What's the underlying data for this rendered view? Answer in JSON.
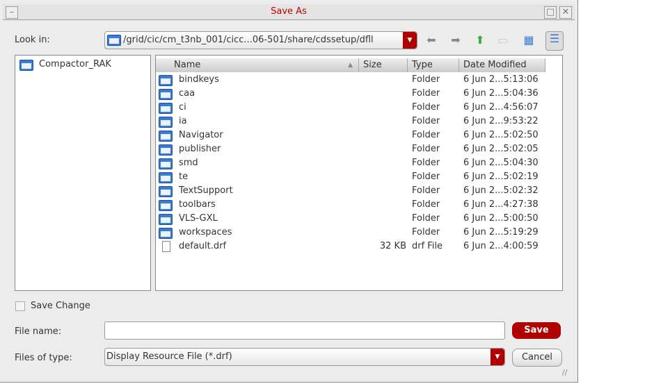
{
  "title": "Save As",
  "look_in_label": "Look in:",
  "look_in_path": "/grid/cic/cm_t3nb_001/cicc...06-501/share/cdssetup/dfll",
  "left_items": [
    "Compactor_RAK"
  ],
  "columns": {
    "name": "Name",
    "size": "Size",
    "type": "Type",
    "date": "Date Modified"
  },
  "files": [
    {
      "name": "bindkeys",
      "size": "",
      "type": "Folder",
      "date": "6 Jun 2...5:13:06",
      "kind": "folder"
    },
    {
      "name": "caa",
      "size": "",
      "type": "Folder",
      "date": "6 Jun 2...5:04:36",
      "kind": "folder"
    },
    {
      "name": "ci",
      "size": "",
      "type": "Folder",
      "date": "6 Jun 2...4:56:07",
      "kind": "folder"
    },
    {
      "name": "ia",
      "size": "",
      "type": "Folder",
      "date": "6 Jun 2...9:53:22",
      "kind": "folder"
    },
    {
      "name": "Navigator",
      "size": "",
      "type": "Folder",
      "date": "6 Jun 2...5:02:50",
      "kind": "folder"
    },
    {
      "name": "publisher",
      "size": "",
      "type": "Folder",
      "date": "6 Jun 2...5:02:05",
      "kind": "folder"
    },
    {
      "name": "smd",
      "size": "",
      "type": "Folder",
      "date": "6 Jun 2...5:04:30",
      "kind": "folder"
    },
    {
      "name": "te",
      "size": "",
      "type": "Folder",
      "date": "6 Jun 2...5:02:19",
      "kind": "folder"
    },
    {
      "name": "TextSupport",
      "size": "",
      "type": "Folder",
      "date": "6 Jun 2...5:02:32",
      "kind": "folder"
    },
    {
      "name": "toolbars",
      "size": "",
      "type": "Folder",
      "date": "6 Jun 2...4:27:38",
      "kind": "folder"
    },
    {
      "name": "VLS-GXL",
      "size": "",
      "type": "Folder",
      "date": "6 Jun 2...5:00:50",
      "kind": "folder"
    },
    {
      "name": "workspaces",
      "size": "",
      "type": "Folder",
      "date": "6 Jun 2...5:19:29",
      "kind": "folder"
    },
    {
      "name": "default.drf",
      "size": "32 KB",
      "type": "drf File",
      "date": "6 Jun 2...4:00:59",
      "kind": "file"
    }
  ],
  "save_change_label": "Save Change",
  "file_name_label": "File name:",
  "file_name_value": "",
  "files_of_type_label": "Files of type:",
  "files_of_type_value": "Display Resource File (*.drf)",
  "save_button": "Save",
  "cancel_button": "Cancel"
}
